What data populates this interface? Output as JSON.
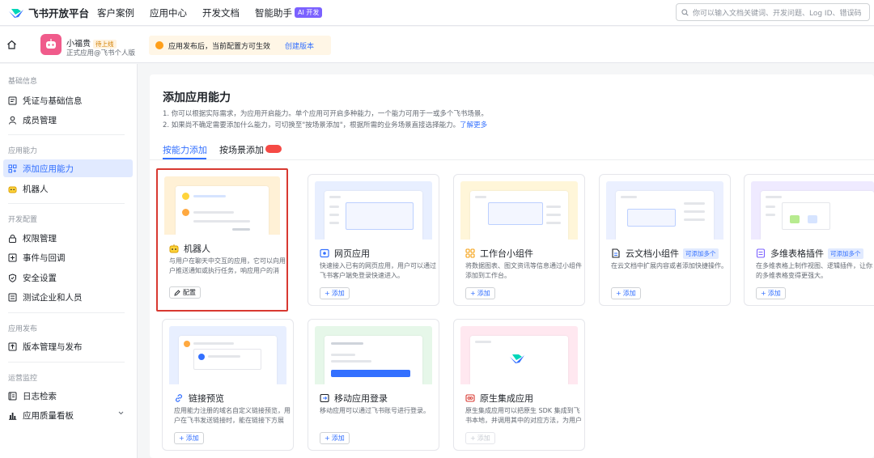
{
  "topbar": {
    "logo_text": "飞书开放平台",
    "nav": [
      "客户案例",
      "应用中心",
      "开发文档",
      "智能助手"
    ],
    "ai_badge": "AI 开发",
    "search_placeholder": "你可以输入文档关键词、开发问题、Log ID、错误码"
  },
  "app": {
    "name": "小福贵",
    "status": "待上线",
    "subtitle": "正式应用@飞书个人版",
    "notice": "应用发布后，当前配置方可生效",
    "notice_link": "创建版本"
  },
  "sidebar": {
    "groups": [
      {
        "title": "基础信息",
        "items": [
          "凭证与基础信息",
          "成员管理"
        ]
      },
      {
        "title": "应用能力",
        "items": [
          "添加应用能力",
          "机器人"
        ]
      },
      {
        "title": "开发配置",
        "items": [
          "权限管理",
          "事件与回调",
          "安全设置",
          "测试企业和人员"
        ]
      },
      {
        "title": "应用发布",
        "items": [
          "版本管理与发布"
        ]
      },
      {
        "title": "运营监控",
        "items": [
          "日志检索",
          "应用质量看板"
        ]
      }
    ]
  },
  "main": {
    "title": "添加应用能力",
    "desc1": "1. 你可以根据实际需求，为应用开启能力。单个应用可开启多种能力，一个能力可用于一或多个飞书场景。",
    "desc2": "2. 如果尚不确定需要添加什么能力，可切换至\"按场景添加\"，根据所需的业务场景直接选择能力。",
    "desc2_link": "了解更多",
    "tabs": [
      "按能力添加",
      "按场景添加"
    ]
  },
  "cards": [
    {
      "title": "机器人",
      "desc": "与用户在聊天中交互的应用，它可以向用户推送通知或执行任务，响应用户的消息。",
      "button": "配置",
      "tag": ""
    },
    {
      "title": "网页应用",
      "desc": "快速接入已有的网页应用，用户可以通过飞书客户端免登录快速进入。",
      "button": "添加",
      "tag": ""
    },
    {
      "title": "工作台小组件",
      "desc": "将数据图表、图文资讯等信息通过小组件添加到工作台。",
      "button": "添加",
      "tag": ""
    },
    {
      "title": "云文档小组件",
      "desc": "在云文档中扩展内容或者添加快捷操作。",
      "button": "添加",
      "tag": "可添加多个"
    },
    {
      "title": "多维表格插件",
      "desc": "在多维表格上制作视图、逻辑插件，让你的多维表格变得更强大。",
      "button": "添加",
      "tag": "可添加多个"
    },
    {
      "title": "链接预览",
      "desc": "应用能力注册的域名自定义链接预览，用户在飞书发送链接时，能在链接下方展示。",
      "button": "添加",
      "tag": ""
    },
    {
      "title": "移动应用登录",
      "desc": "移动应用可以通过飞书账号进行登录。",
      "button": "添加",
      "tag": ""
    },
    {
      "title": "原生集成应用",
      "desc": "原生集成应用可以把原生 SDK 集成到飞书本地，并调用其中的对应方法，为用户提供。",
      "button": "添加",
      "tag": ""
    }
  ]
}
